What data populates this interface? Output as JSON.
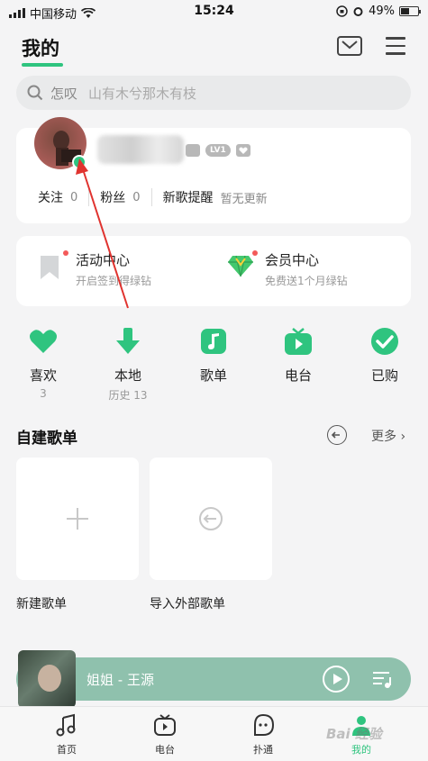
{
  "status_bar": {
    "carrier": "中国移动",
    "time": "15:24",
    "battery": "49%",
    "battery_level": 0.49
  },
  "header": {
    "title": "我的"
  },
  "search": {
    "placeholder": "怎叹",
    "hint": "山有木兮那木有枝"
  },
  "profile": {
    "badges": [
      "LV1"
    ],
    "stats": [
      {
        "label": "关注",
        "value": "0"
      },
      {
        "label": "粉丝",
        "value": "0"
      },
      {
        "label": "新歌提醒",
        "value": "暂无更新"
      }
    ]
  },
  "promos": [
    {
      "title": "活动中心",
      "subtitle": "开启签到得绿钻",
      "icon": "bookmark-icon"
    },
    {
      "title": "会员中心",
      "subtitle": "免费送1个月绿钻",
      "icon": "diamond-icon"
    }
  ],
  "quick_access": [
    {
      "label": "喜欢",
      "sub": "3",
      "icon": "heart-icon"
    },
    {
      "label": "本地",
      "sub": "历史 13",
      "icon": "download-icon"
    },
    {
      "label": "歌单",
      "sub": "",
      "icon": "music-note-icon"
    },
    {
      "label": "电台",
      "sub": "",
      "icon": "radio-tv-icon"
    },
    {
      "label": "已购",
      "sub": "",
      "icon": "check-circle-icon"
    }
  ],
  "playlists": {
    "title": "自建歌单",
    "more": "更多",
    "new_label": "新建歌单",
    "import_label": "导入外部歌单"
  },
  "player": {
    "song": "姐姐 - 王源"
  },
  "tabs": [
    {
      "label": "首页",
      "icon": "music-note-icon"
    },
    {
      "label": "电台",
      "icon": "radio-icon"
    },
    {
      "label": "扑通",
      "icon": "chat-face-icon"
    },
    {
      "label": "我的",
      "icon": "user-icon",
      "active": true
    }
  ],
  "watermark": "Bai 经验",
  "colors": {
    "accent": "#2fc47f",
    "player_bg": "#8fc1ad",
    "annotation_arrow": "#e0332f"
  }
}
